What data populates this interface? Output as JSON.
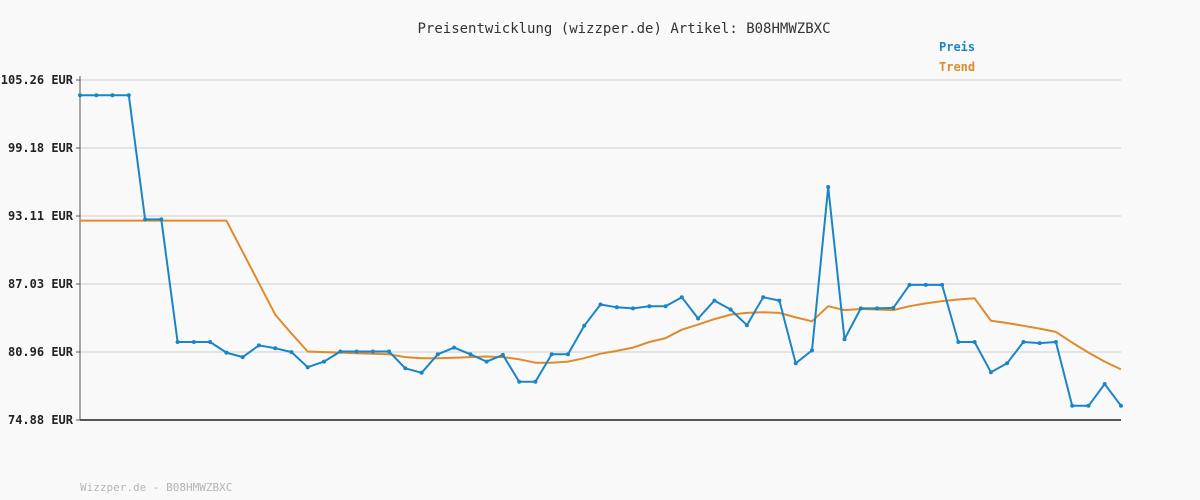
{
  "title": "Preisentwicklung (wizzper.de) Artikel: B08HMWZBXC",
  "footer": "Wizzper.de - B08HMWZBXC",
  "colors": {
    "preis": "#1a85c6",
    "trend": "#e08a2b",
    "grid": "#e3e3e3",
    "axis": "#555555",
    "background": "#f9f9f9"
  },
  "chart_data": {
    "type": "line",
    "title": "Preisentwicklung (wizzper.de) Artikel: B08HMWZBXC",
    "xlabel": "",
    "ylabel": "",
    "ylim": [
      74.88,
      105.26
    ],
    "y_ticks": [
      "105.26 EUR",
      "99.18 EUR",
      "93.11 EUR",
      "87.03 EUR",
      "80.96 EUR",
      "74.88 EUR"
    ],
    "grid": true,
    "legend_placement": "top-right",
    "series": [
      {
        "name": "Preis",
        "color": "#1a85c6",
        "markers": true,
        "values": [
          103.9,
          103.9,
          103.9,
          103.9,
          92.8,
          92.8,
          81.85,
          81.85,
          81.85,
          80.9,
          80.5,
          81.55,
          81.3,
          80.95,
          79.6,
          80.1,
          81.0,
          81.0,
          81.0,
          81.0,
          79.5,
          79.1,
          80.75,
          81.35,
          80.75,
          80.1,
          80.7,
          78.3,
          78.3,
          80.75,
          80.75,
          83.3,
          85.2,
          84.95,
          84.85,
          85.05,
          85.05,
          85.85,
          83.95,
          85.55,
          84.75,
          83.35,
          85.85,
          85.55,
          79.95,
          81.1,
          95.7,
          82.1,
          84.85,
          84.85,
          84.9,
          86.95,
          86.95,
          86.95,
          81.85,
          81.85,
          79.15,
          79.95,
          81.85,
          81.75,
          81.85,
          76.15,
          76.15,
          78.1,
          76.15
        ]
      },
      {
        "name": "Trend",
        "color": "#e08a2b",
        "markers": false,
        "values": [
          92.7,
          92.7,
          92.7,
          92.7,
          92.7,
          92.7,
          92.7,
          92.7,
          92.7,
          92.7,
          89.9,
          87.1,
          84.3,
          82.6,
          81.0,
          80.95,
          80.9,
          80.85,
          80.8,
          80.75,
          80.5,
          80.4,
          80.4,
          80.45,
          80.5,
          80.55,
          80.5,
          80.3,
          80.0,
          80.0,
          80.1,
          80.4,
          80.8,
          81.05,
          81.35,
          81.85,
          82.2,
          82.95,
          83.4,
          83.9,
          84.3,
          84.45,
          84.5,
          84.45,
          84.05,
          83.7,
          85.05,
          84.7,
          84.8,
          84.75,
          84.7,
          85.05,
          85.3,
          85.5,
          85.65,
          85.75,
          83.75,
          83.55,
          83.3,
          83.05,
          82.75,
          81.8,
          80.9,
          80.1,
          79.4
        ]
      }
    ]
  }
}
